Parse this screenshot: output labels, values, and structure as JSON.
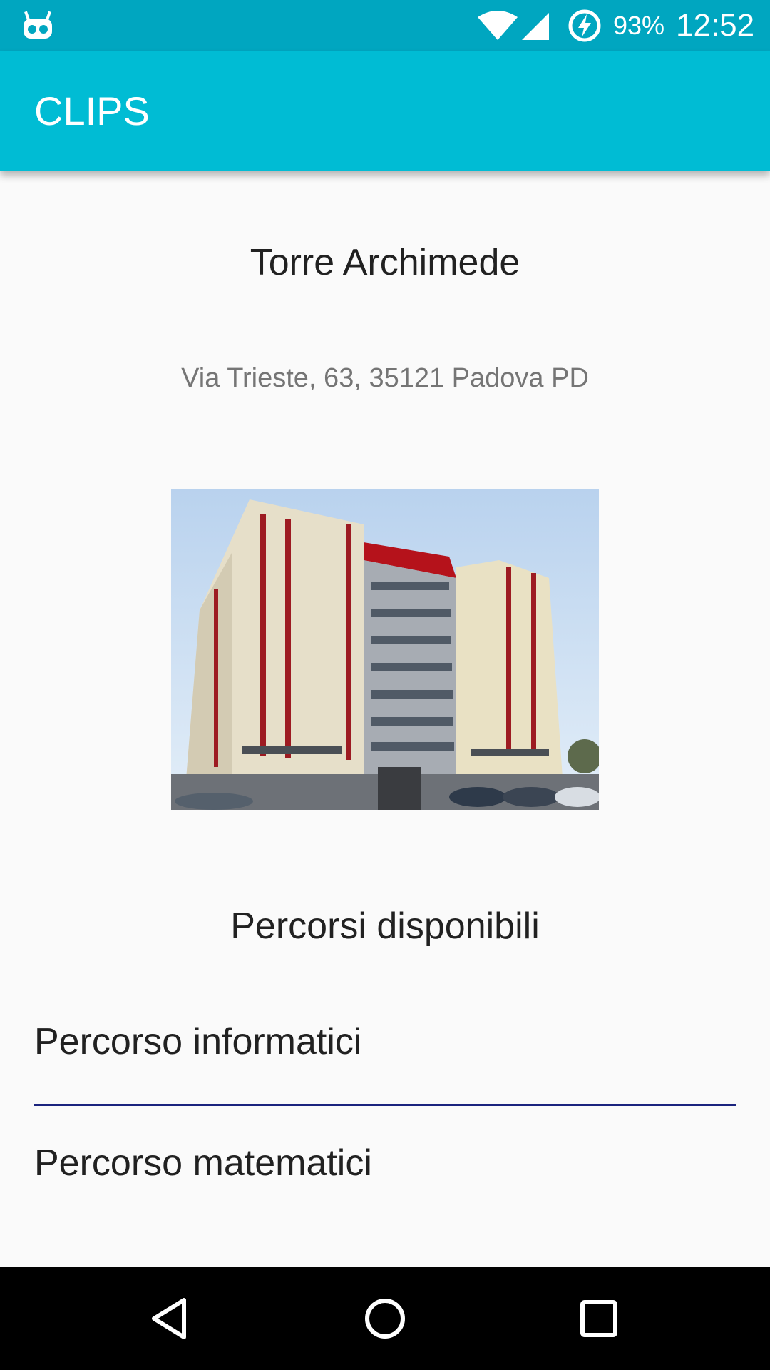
{
  "status_bar": {
    "left_icon": "android-debug-icon",
    "wifi_icon": "wifi-icon",
    "signal_icon": "cell-signal-icon",
    "battery_icon": "battery-charging-icon",
    "battery_text": "93%",
    "time": "12:52"
  },
  "app_bar": {
    "title": "CLIPS"
  },
  "place": {
    "name": "Torre Archimede",
    "address": "Via Trieste, 63, 35121 Padova PD",
    "photo": "building-photo"
  },
  "routes": {
    "section_title": "Percorsi disponibili",
    "items": [
      {
        "label": "Percorso informatici"
      },
      {
        "label": "Percorso matematici"
      }
    ]
  },
  "nav_bar": {
    "back_icon": "back-triangle-icon",
    "home_icon": "home-circle-icon",
    "recents_icon": "recents-square-icon"
  },
  "colors": {
    "status_bar": "#00a6c0",
    "app_bar": "#00bcd4",
    "divider": "#1a237e",
    "background": "#fafafa"
  }
}
